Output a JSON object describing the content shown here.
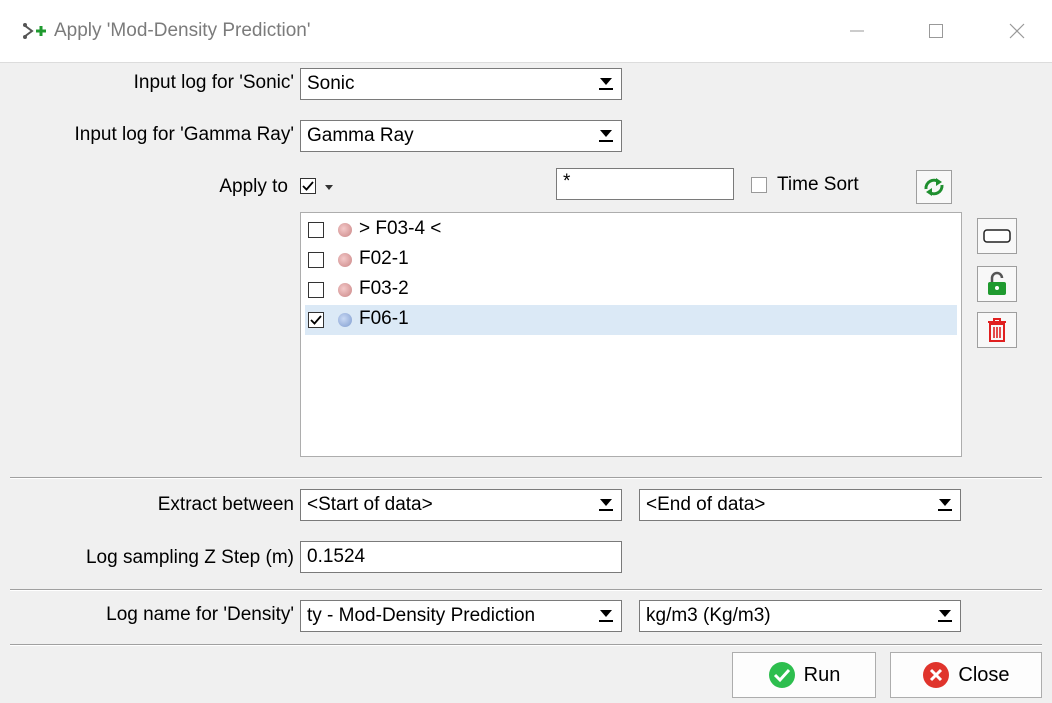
{
  "window": {
    "title": "Apply 'Mod-Density Prediction'"
  },
  "form": {
    "sonic_label": "Input log for 'Sonic'",
    "sonic_value": "Sonic",
    "gamma_label": "Input log for 'Gamma Ray'",
    "gamma_value": "Gamma Ray",
    "apply_to_label": "Apply to",
    "filter_value": "*",
    "time_sort_label": "Time Sort",
    "wells": [
      {
        "label": "> F03-4 <",
        "checked": false,
        "selected": false,
        "status": "red"
      },
      {
        "label": "F02-1",
        "checked": false,
        "selected": false,
        "status": "red"
      },
      {
        "label": "F03-2",
        "checked": false,
        "selected": false,
        "status": "red"
      },
      {
        "label": "F06-1",
        "checked": true,
        "selected": true,
        "status": "blue"
      }
    ],
    "extract_label": "Extract between",
    "extract_start": "<Start of data>",
    "extract_end": "<End of data>",
    "zstep_label": "Log sampling Z Step (m)",
    "zstep_value": "0.1524",
    "density_label": "Log name for 'Density'",
    "density_value": "ty - Mod-Density Prediction",
    "density_unit": "kg/m3 (Kg/m3)"
  },
  "buttons": {
    "run": "Run",
    "close": "Close"
  },
  "colors": {
    "run_icon": "#2dbe4e",
    "close_icon": "#e0342c",
    "refresh_icon": "#1f8f2f",
    "lock_icon": "#1f9a2f",
    "trash_icon": "#e02020",
    "selected_row": "#dbe9f6"
  }
}
